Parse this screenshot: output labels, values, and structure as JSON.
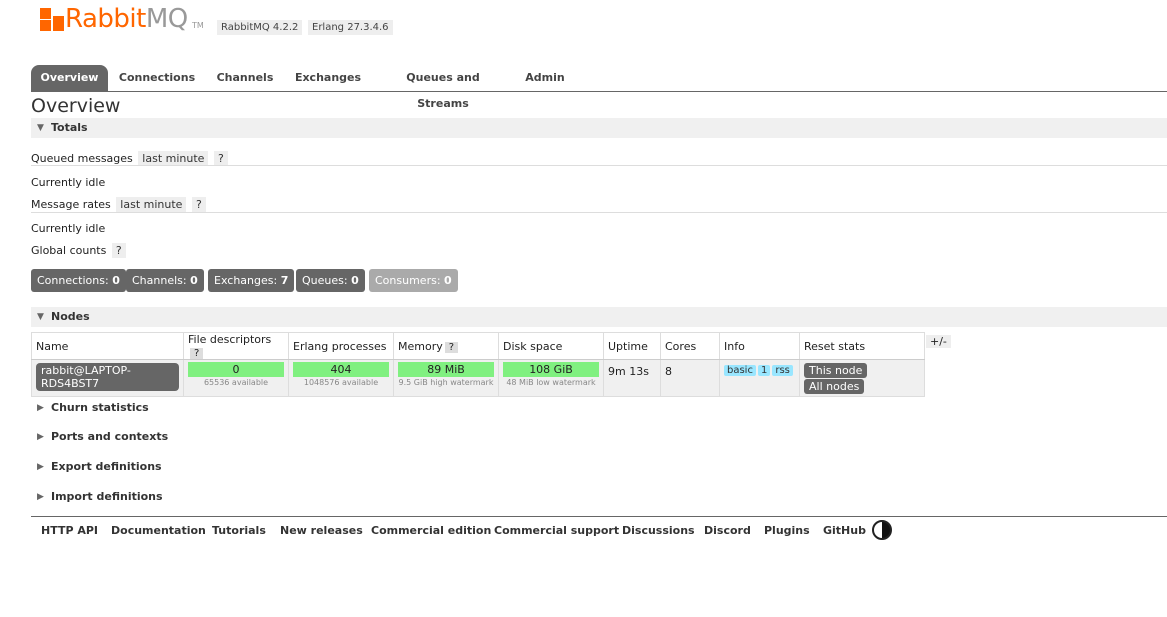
{
  "header": {
    "logo_primary": "Rabbit",
    "logo_secondary": "MQ",
    "logo_tm": "TM",
    "version_label": "RabbitMQ 4.2.2",
    "erlang_label": "Erlang 27.3.4.6",
    "brand_color": "#ff6600"
  },
  "tabs": [
    "Overview",
    "Connections",
    "Channels",
    "Exchanges",
    "Queues and Streams",
    "Admin"
  ],
  "active_tab": "Overview",
  "page_title": "Overview",
  "totals": {
    "heading": "Totals",
    "queued_messages_label": "Queued messages",
    "queued_messages_range": "last minute",
    "help": "?",
    "idle_text_1": "Currently idle",
    "message_rates_label": "Message rates",
    "message_rates_range": "last minute",
    "idle_text_2": "Currently idle",
    "global_counts_label": "Global counts"
  },
  "counts": [
    {
      "label": "Connections:",
      "value": "0"
    },
    {
      "label": "Channels:",
      "value": "0"
    },
    {
      "label": "Exchanges:",
      "value": "7"
    },
    {
      "label": "Queues:",
      "value": "0"
    },
    {
      "label": "Consumers:",
      "value": "0"
    }
  ],
  "nodes": {
    "heading": "Nodes",
    "columns": [
      "Name",
      "File descriptors",
      "Erlang processes",
      "Memory",
      "Disk space",
      "Uptime",
      "Cores",
      "Info",
      "Reset stats"
    ],
    "plusminus": "+/-",
    "row": {
      "name": "rabbit@LAPTOP-RDS4BST7",
      "fd_value": "0",
      "fd_sub": "65536 available",
      "proc_value": "404",
      "proc_sub": "1048576 available",
      "mem_value": "89 MiB",
      "mem_sub": "9.5 GiB high watermark",
      "disk_value": "108 GiB",
      "disk_sub": "48 MiB low watermark",
      "uptime": "9m 13s",
      "cores": "8",
      "info": [
        "basic",
        "1",
        "rss"
      ],
      "reset_this": "This node",
      "reset_all": "All nodes"
    }
  },
  "collapsed_sections": [
    "Churn statistics",
    "Ports and contexts",
    "Export definitions",
    "Import definitions"
  ],
  "footer_links": [
    "HTTP API",
    "Documentation",
    "Tutorials",
    "New releases",
    "Commercial edition",
    "Commercial support",
    "Discussions",
    "Discord",
    "Plugins",
    "GitHub"
  ],
  "icons": {
    "collapse": "triangle-down-icon",
    "expand": "triangle-right-icon",
    "theme": "contrast-icon"
  },
  "colors": {
    "tab_active": "#666666",
    "bar_green": "#80f080",
    "info_blue": "#99e6ff"
  }
}
